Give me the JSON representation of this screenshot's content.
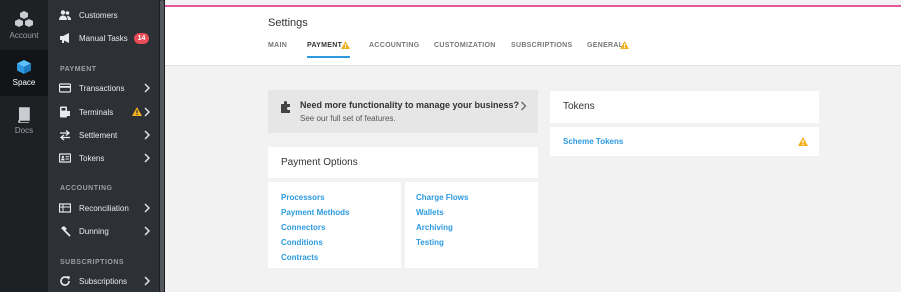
{
  "rail": [
    {
      "label": "Account",
      "icon": "account-cubes-icon"
    },
    {
      "label": "Space",
      "icon": "space-cube-icon"
    },
    {
      "label": "Docs",
      "icon": "book-icon"
    }
  ],
  "sidebar": {
    "top_items": [
      {
        "label": "Customers",
        "icon": "customers-icon"
      },
      {
        "label": "Manual Tasks",
        "icon": "megaphone-icon",
        "badge": "14"
      }
    ],
    "sections": [
      {
        "title": "PAYMENT"
      },
      {
        "title": "ACCOUNTING"
      },
      {
        "title": "SUBSCRIPTIONS"
      }
    ],
    "payment_items": [
      {
        "label": "Transactions",
        "icon": "card-icon"
      },
      {
        "label": "Terminals",
        "icon": "terminal-icon"
      },
      {
        "label": "Settlement",
        "icon": "transfer-icon"
      },
      {
        "label": "Tokens",
        "icon": "id-card-icon"
      }
    ],
    "accounting_items": [
      {
        "label": "Reconciliation",
        "icon": "ledger-icon"
      },
      {
        "label": "Dunning",
        "icon": "hammer-icon"
      }
    ],
    "subscription_items": [
      {
        "label": "Subscriptions",
        "icon": "refresh-icon"
      }
    ]
  },
  "page": {
    "title": "Settings",
    "tabs": [
      "MAIN",
      "PAYMENT",
      "ACCOUNTING",
      "CUSTOMIZATION",
      "SUBSCRIPTIONS",
      "GENERAL"
    ],
    "active_tab": "PAYMENT"
  },
  "promo": {
    "title": "Need more functionality to manage your business?",
    "subtitle": "See our full set of features."
  },
  "payment_options": {
    "title": "Payment Options",
    "left_links": [
      "Processors",
      "Payment Methods",
      "Connectors",
      "Conditions",
      "Contracts"
    ],
    "right_links": [
      "Charge Flows",
      "Wallets",
      "Archiving",
      "Testing"
    ]
  },
  "tokens_card": {
    "title": "Tokens",
    "link": "Scheme Tokens"
  },
  "colors": {
    "accent": "#2d9ae0",
    "warning": "#f2b01e",
    "badge": "#e84b55",
    "top_line": "#e6569b"
  }
}
